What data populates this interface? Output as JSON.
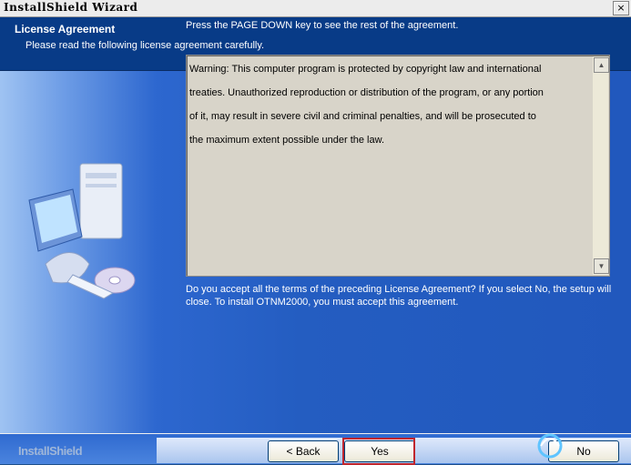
{
  "window": {
    "title": "InstallShield Wizard",
    "close_label": "×"
  },
  "header": {
    "title": "License Agreement",
    "subtitle": "Please read the following license agreement carefully."
  },
  "main": {
    "instruction": "Press the PAGE DOWN key to see the rest of the agreement.",
    "license_lines": [
      "Warning: This computer program is protected by copyright law and international",
      "treaties. Unauthorized reproduction or distribution of the program, or any portion",
      "of it, may result in severe civil and criminal penalties, and will be prosecuted to",
      "the maximum extent possible under the law."
    ],
    "question": "Do you accept all the terms of the preceding License Agreement?  If you select No,  the setup will close.  To install OTNM2000, you must accept this agreement."
  },
  "footer": {
    "brand": "InstallShield",
    "back_label": "< Back",
    "yes_label": "Yes",
    "no_label": "No"
  },
  "colors": {
    "header_bg": "#083b87",
    "panel_bg": "#245dc1",
    "highlight": "#c0262d"
  },
  "icons": {
    "scroll_up": "up-arrow-icon",
    "scroll_down": "down-arrow-icon",
    "computer_art": "computer-setup-icon"
  }
}
